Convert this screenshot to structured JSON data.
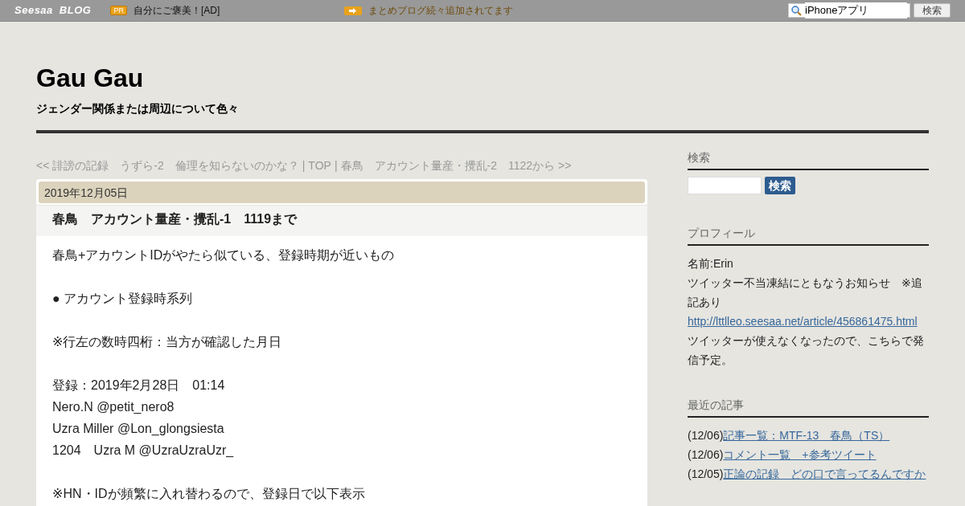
{
  "topbar": {
    "logo": "Seesaa",
    "logo_suffix": "BLOG",
    "pr_badge": "PR",
    "ad_text": "自分にご褒美！[AD]",
    "notice": "まとめブログ続々追加されてます",
    "search_value": "iPhoneアプリ",
    "search_button": "検索"
  },
  "header": {
    "title": "Gau Gau",
    "subtitle": "ジェンダー関係または周辺について色々"
  },
  "nav": {
    "prev": "<< 誹謗の記録　うずら-2　倫理を知らないのかな？",
    "separator_1": "|",
    "top": "TOP",
    "separator_2": "|",
    "next": "春鳥　アカウント量産・攪乱-2　1122から >>"
  },
  "article": {
    "date": "2019年12月05日",
    "title": "春鳥　アカウント量産・攪乱-1　1119まで",
    "paragraphs": [
      [
        "春鳥+アカウントIDがやたら似ている、登録時期が近いもの"
      ],
      [
        "● アカウント登録時系列"
      ],
      [
        "※行左の数時四桁：当方が確認した月日"
      ],
      [
        "登録：2019年2月28日　01:14",
        "Nero.N @petit_nero8",
        "Uzra Miller @Lon_glongsiesta",
        "1204　Uzra M @UzraUzraUzr_"
      ],
      [
        "※HN・IDが頻繁に入れ替わるので、登録日で以下表示"
      ]
    ]
  },
  "sidebar": {
    "search": {
      "heading": "検索",
      "button": "検索"
    },
    "profile": {
      "heading": "プロフィール",
      "name": "名前:Erin",
      "lines": [
        {
          "kind": "text",
          "text": "ツイッター不当凍結にともなうお知らせ　※追記あり"
        },
        {
          "kind": "link",
          "text": "http://lttlleo.seesaa.net/article/456861475.html"
        },
        {
          "kind": "text",
          "text": "ツイッターが使えなくなったので、こちらで発信予定。"
        }
      ]
    },
    "recent": {
      "heading": "最近の記事",
      "items": [
        {
          "date": "(12/06)",
          "title": "記事一覧：MTF-13　春鳥（TS）"
        },
        {
          "date": "(12/06)",
          "title": "コメント一覧　+参考ツイート"
        },
        {
          "date": "(12/05)",
          "title": "正論の記録　どの口で言ってるんですか"
        }
      ]
    }
  }
}
